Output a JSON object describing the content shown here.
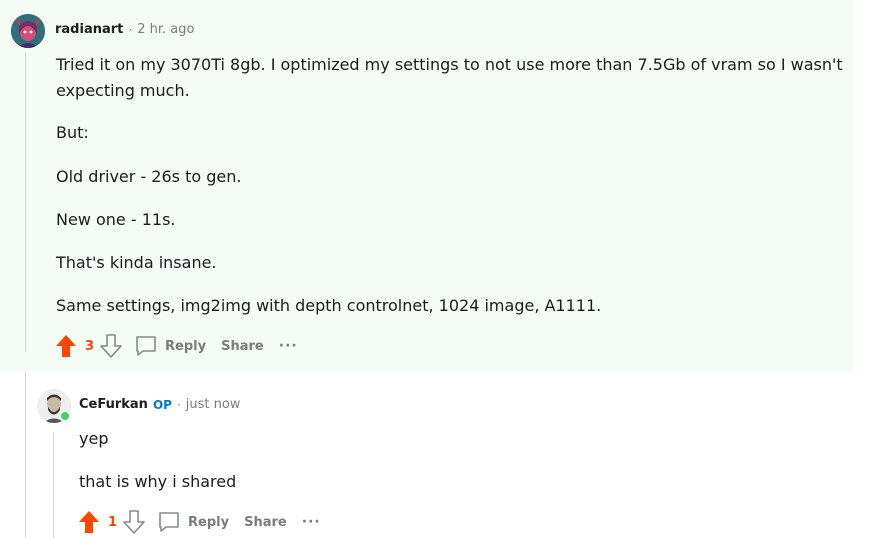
{
  "comment1": {
    "author": "radianart",
    "separator": "·",
    "time": "2 hr. ago",
    "body": [
      "Tried it on my 3070Ti 8gb. I optimized my settings to not use more than 7.5Gb of vram so I wasn't",
      "expecting much.",
      "But:",
      "Old driver - 26s to gen.",
      "New one - 11s.",
      "That's kinda insane.",
      "Same settings, img2img with depth controlnet, 1024 image, A1111."
    ],
    "score": "3",
    "reply_label": "Reply",
    "share_label": "Share",
    "more_label": "···"
  },
  "comment2": {
    "author": "CeFurkan",
    "op_badge": "OP",
    "separator": "·",
    "time": "just now",
    "body": [
      "yep",
      "that is why i shared"
    ],
    "score": "1",
    "reply_label": "Reply",
    "share_label": "Share",
    "more_label": "···"
  },
  "colors": {
    "upvote": "#ff4500",
    "muted": "#7c7c7c",
    "op_blue": "#0079d3",
    "highlight_bg": "#f5fbf5",
    "online": "#46d160"
  }
}
